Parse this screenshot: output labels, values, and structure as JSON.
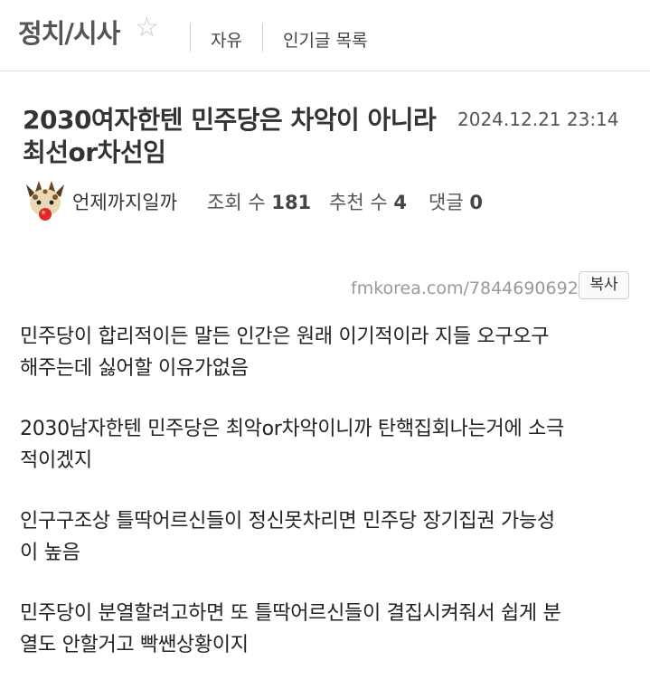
{
  "header": {
    "board_title": "정치/시사",
    "nav": [
      "자유",
      "인기글 목록"
    ]
  },
  "post": {
    "title_line1": "2030여자한텐 민주당은 차악이 아니라",
    "title_line2": "최선or차선임",
    "date": "2024.12.21 23:14",
    "author": "언제까지일까",
    "views_label": "조회 수",
    "views": "181",
    "recommends_label": "추천 수",
    "recommends": "4",
    "comments_label": "댓글",
    "comments": "0",
    "url": "fmkorea.com/7844690692",
    "copy_label": "복사",
    "paragraphs": [
      [
        "민주당이 합리적이든 말든 인간은 원래 이기적이라 지들 오구오구",
        "해주는데 싫어할 이유가없음"
      ],
      [
        "2030남자한텐 민주당은 최악or차악이니까 탄핵집회나는거에 소극",
        "적이겠지"
      ],
      [
        "인구구조상 틀딱어르신들이 정신못차리면 민주당 장기집권 가능성",
        "이 높음"
      ],
      [
        "민주당이 분열할려고하면 또 틀딱어르신들이 결집시켜줘서 쉽게 분",
        "열도 안할거고 빡쌘상황이지"
      ]
    ]
  },
  "icons": {
    "favorite": "star-outline-icon",
    "avatar": "giraffe-avatar-icon"
  },
  "colors": {
    "text": "#222222",
    "muted": "#9a9a9a",
    "border": "#dcdcdc"
  }
}
